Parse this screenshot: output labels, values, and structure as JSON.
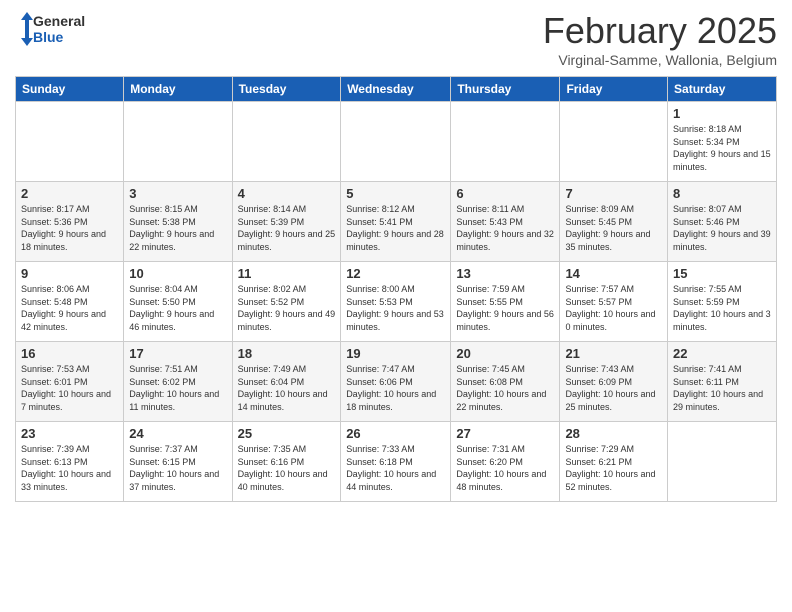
{
  "header": {
    "logo": {
      "general": "General",
      "blue": "Blue"
    },
    "title": "February 2025",
    "subtitle": "Virginal-Samme, Wallonia, Belgium"
  },
  "calendar": {
    "days_of_week": [
      "Sunday",
      "Monday",
      "Tuesday",
      "Wednesday",
      "Thursday",
      "Friday",
      "Saturday"
    ],
    "weeks": [
      [
        {
          "day": "",
          "info": ""
        },
        {
          "day": "",
          "info": ""
        },
        {
          "day": "",
          "info": ""
        },
        {
          "day": "",
          "info": ""
        },
        {
          "day": "",
          "info": ""
        },
        {
          "day": "",
          "info": ""
        },
        {
          "day": "1",
          "info": "Sunrise: 8:18 AM\nSunset: 5:34 PM\nDaylight: 9 hours and 15 minutes."
        }
      ],
      [
        {
          "day": "2",
          "info": "Sunrise: 8:17 AM\nSunset: 5:36 PM\nDaylight: 9 hours and 18 minutes."
        },
        {
          "day": "3",
          "info": "Sunrise: 8:15 AM\nSunset: 5:38 PM\nDaylight: 9 hours and 22 minutes."
        },
        {
          "day": "4",
          "info": "Sunrise: 8:14 AM\nSunset: 5:39 PM\nDaylight: 9 hours and 25 minutes."
        },
        {
          "day": "5",
          "info": "Sunrise: 8:12 AM\nSunset: 5:41 PM\nDaylight: 9 hours and 28 minutes."
        },
        {
          "day": "6",
          "info": "Sunrise: 8:11 AM\nSunset: 5:43 PM\nDaylight: 9 hours and 32 minutes."
        },
        {
          "day": "7",
          "info": "Sunrise: 8:09 AM\nSunset: 5:45 PM\nDaylight: 9 hours and 35 minutes."
        },
        {
          "day": "8",
          "info": "Sunrise: 8:07 AM\nSunset: 5:46 PM\nDaylight: 9 hours and 39 minutes."
        }
      ],
      [
        {
          "day": "9",
          "info": "Sunrise: 8:06 AM\nSunset: 5:48 PM\nDaylight: 9 hours and 42 minutes."
        },
        {
          "day": "10",
          "info": "Sunrise: 8:04 AM\nSunset: 5:50 PM\nDaylight: 9 hours and 46 minutes."
        },
        {
          "day": "11",
          "info": "Sunrise: 8:02 AM\nSunset: 5:52 PM\nDaylight: 9 hours and 49 minutes."
        },
        {
          "day": "12",
          "info": "Sunrise: 8:00 AM\nSunset: 5:53 PM\nDaylight: 9 hours and 53 minutes."
        },
        {
          "day": "13",
          "info": "Sunrise: 7:59 AM\nSunset: 5:55 PM\nDaylight: 9 hours and 56 minutes."
        },
        {
          "day": "14",
          "info": "Sunrise: 7:57 AM\nSunset: 5:57 PM\nDaylight: 10 hours and 0 minutes."
        },
        {
          "day": "15",
          "info": "Sunrise: 7:55 AM\nSunset: 5:59 PM\nDaylight: 10 hours and 3 minutes."
        }
      ],
      [
        {
          "day": "16",
          "info": "Sunrise: 7:53 AM\nSunset: 6:01 PM\nDaylight: 10 hours and 7 minutes."
        },
        {
          "day": "17",
          "info": "Sunrise: 7:51 AM\nSunset: 6:02 PM\nDaylight: 10 hours and 11 minutes."
        },
        {
          "day": "18",
          "info": "Sunrise: 7:49 AM\nSunset: 6:04 PM\nDaylight: 10 hours and 14 minutes."
        },
        {
          "day": "19",
          "info": "Sunrise: 7:47 AM\nSunset: 6:06 PM\nDaylight: 10 hours and 18 minutes."
        },
        {
          "day": "20",
          "info": "Sunrise: 7:45 AM\nSunset: 6:08 PM\nDaylight: 10 hours and 22 minutes."
        },
        {
          "day": "21",
          "info": "Sunrise: 7:43 AM\nSunset: 6:09 PM\nDaylight: 10 hours and 25 minutes."
        },
        {
          "day": "22",
          "info": "Sunrise: 7:41 AM\nSunset: 6:11 PM\nDaylight: 10 hours and 29 minutes."
        }
      ],
      [
        {
          "day": "23",
          "info": "Sunrise: 7:39 AM\nSunset: 6:13 PM\nDaylight: 10 hours and 33 minutes."
        },
        {
          "day": "24",
          "info": "Sunrise: 7:37 AM\nSunset: 6:15 PM\nDaylight: 10 hours and 37 minutes."
        },
        {
          "day": "25",
          "info": "Sunrise: 7:35 AM\nSunset: 6:16 PM\nDaylight: 10 hours and 40 minutes."
        },
        {
          "day": "26",
          "info": "Sunrise: 7:33 AM\nSunset: 6:18 PM\nDaylight: 10 hours and 44 minutes."
        },
        {
          "day": "27",
          "info": "Sunrise: 7:31 AM\nSunset: 6:20 PM\nDaylight: 10 hours and 48 minutes."
        },
        {
          "day": "28",
          "info": "Sunrise: 7:29 AM\nSunset: 6:21 PM\nDaylight: 10 hours and 52 minutes."
        },
        {
          "day": "",
          "info": ""
        }
      ]
    ]
  }
}
